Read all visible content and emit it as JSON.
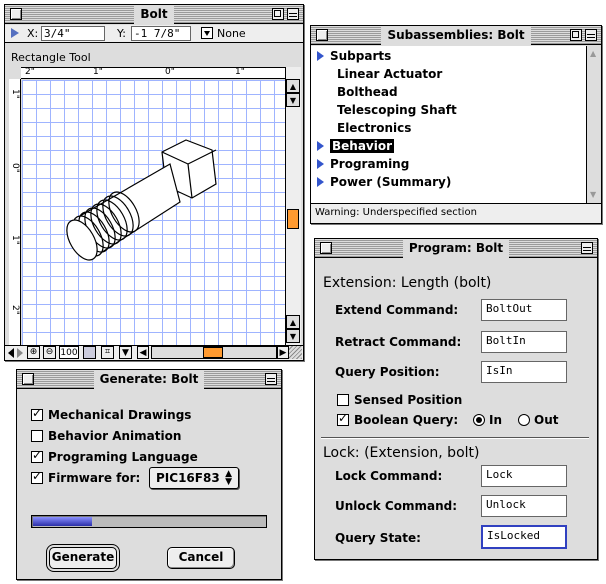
{
  "bolt_window": {
    "title": "Bolt",
    "x_label": "X:",
    "x_value": "3/4\"",
    "y_label": "Y:",
    "y_value": "-1 7/8\"",
    "snap_value": "None",
    "tool_label": "Rectangle Tool",
    "ruler_h": [
      "2\"",
      "1\"",
      "0\"",
      "1\""
    ],
    "ruler_v": [
      "1\"",
      "0\"",
      "1\"",
      "2\""
    ],
    "zoom_value": "100"
  },
  "subassemblies_window": {
    "title": "Subassemblies: Bolt",
    "items": [
      {
        "label": "Subparts",
        "expandable": true,
        "selected": false
      },
      {
        "label": "Linear Actuator",
        "expandable": false,
        "selected": false
      },
      {
        "label": "Bolthead",
        "expandable": false,
        "selected": false
      },
      {
        "label": "Telescoping Shaft",
        "expandable": false,
        "selected": false
      },
      {
        "label": "Electronics",
        "expandable": false,
        "selected": false
      },
      {
        "label": "Behavior",
        "expandable": true,
        "selected": true
      },
      {
        "label": "Programing",
        "expandable": true,
        "selected": false
      },
      {
        "label": "Power (Summary)",
        "expandable": true,
        "selected": false
      }
    ],
    "status": "Warning: Underspecified section"
  },
  "program_window": {
    "title": "Program: Bolt",
    "section1": "Extension: Length (bolt)",
    "extend_label": "Extend Command:",
    "extend_value": "BoltOut",
    "retract_label": "Retract Command:",
    "retract_value": "BoltIn",
    "query_pos_label": "Query Position:",
    "query_pos_value": "IsIn",
    "sensed_label": "Sensed Position",
    "boolean_label": "Boolean Query:",
    "radio_in": "In",
    "radio_out": "Out",
    "section2": "Lock: (Extension, bolt)",
    "lock_label": "Lock Command:",
    "lock_value": "Lock",
    "unlock_label": "Unlock Command:",
    "unlock_value": "Unlock",
    "query_state_label": "Query State:",
    "query_state_value": "IsLocked"
  },
  "generate_window": {
    "title": "Generate: Bolt",
    "opt_mech": "Mechanical Drawings",
    "opt_behavior": "Behavior Animation",
    "opt_prog": "Programing Language",
    "opt_firmware": "Firmware for:",
    "firmware_value": "PIC16F83",
    "progress": 0.25,
    "generate_label": "Generate",
    "cancel_label": "Cancel"
  },
  "colors": {
    "grid_line": "#9fb4ff",
    "progress_fill": "#3a44c8",
    "scroll_thumb": "#ff9a30",
    "selection": "#000000"
  }
}
